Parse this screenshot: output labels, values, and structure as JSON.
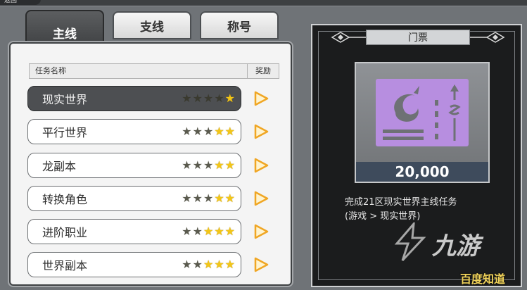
{
  "title_tag": "返回",
  "tabs": [
    {
      "label": "主线",
      "active": true
    },
    {
      "label": "支线",
      "active": false
    },
    {
      "label": "称号",
      "active": false
    }
  ],
  "table_header": {
    "name": "任务名称",
    "reward": "奖励"
  },
  "quests": [
    {
      "name": "现实世界",
      "stars_on": 1,
      "selected": true
    },
    {
      "name": "平行世界",
      "stars_on": 2,
      "selected": false
    },
    {
      "name": "龙副本",
      "stars_on": 2,
      "selected": false
    },
    {
      "name": "转换角色",
      "stars_on": 2,
      "selected": false
    },
    {
      "name": "进阶职业",
      "stars_on": 3,
      "selected": false
    },
    {
      "name": "世界副本",
      "stars_on": 3,
      "selected": false
    }
  ],
  "ticket": {
    "header": "门票",
    "amount": "20,000",
    "desc_line1": "完成21区现实世界主线任务",
    "desc_line2": "(游戏 > 现实世界)"
  },
  "watermark": {
    "main": "九游",
    "bottom": "百度知道"
  },
  "colors": {
    "star_on": "#f3c617",
    "ticket_art": "#b78ee0",
    "play": "#f0a623"
  }
}
